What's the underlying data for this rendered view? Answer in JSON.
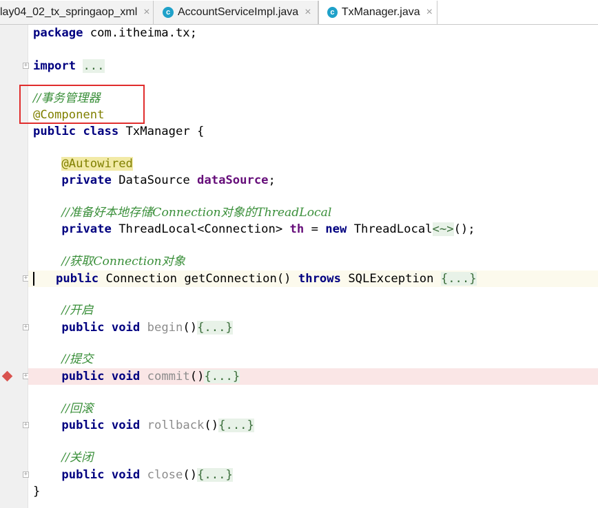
{
  "tabs": [
    {
      "label": "lay04_02_tx_springaop_xml",
      "active": false,
      "icon": "none"
    },
    {
      "label": "AccountServiceImpl.java",
      "active": false,
      "icon": "java-class-icon"
    },
    {
      "label": "TxManager.java",
      "active": true,
      "icon": "java-class-icon"
    }
  ],
  "tab_close_glyph": "×",
  "code": {
    "package_kw": "package",
    "package_name": " com.itheima.tx;",
    "import_kw": "import",
    "import_fold": "...",
    "comment_tx_manager": "//事务管理器",
    "annotation_component": "@Component",
    "public_kw": "public",
    "class_kw": "class",
    "class_decl": " TxManager {",
    "annotation_autowired": "@Autowired",
    "private_kw": "private",
    "datasource_type": " DataSource ",
    "datasource_field": "dataSource",
    "semicolon": ";",
    "comment_threadlocal": "//准备好本地存储Connection对象的ThreadLocal",
    "threadlocal_decl": " ThreadLocal<Connection> ",
    "th_field": "th",
    "assign": " = ",
    "new_kw": "new",
    "threadlocal_ctor": " ThreadLocal",
    "diamond": "<~>",
    "ctor_end": "();",
    "comment_get_connection": "//获取Connection对象",
    "get_connection_sig": " Connection getConnection() ",
    "throws_kw": "throws",
    "sqlexception": " SQLException ",
    "body_fold": "{...}",
    "comment_begin": "//开启",
    "void_kw": "void",
    "method_begin": "begin",
    "comment_commit": "//提交",
    "method_commit": "commit",
    "comment_rollback": "//回滚",
    "method_rollback": "rollback",
    "comment_close": "//关闭",
    "method_close": "close",
    "parens": "()",
    "closing_brace": "}"
  },
  "colors": {
    "keyword": "#000080",
    "comment": "#3a8f3a",
    "annotation": "#808000",
    "field": "#660e7a",
    "breakpoint": "#d9534f",
    "highlight_box": "#e02c2c"
  }
}
